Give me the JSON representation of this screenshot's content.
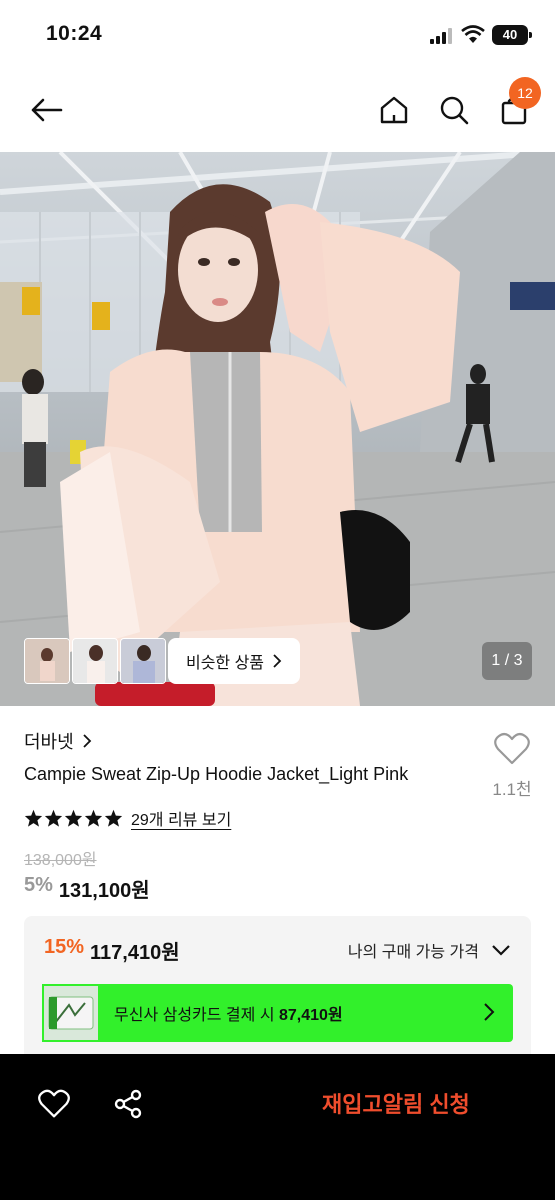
{
  "status_bar": {
    "time": "10:24",
    "battery": "40"
  },
  "nav": {
    "cart_count": "12"
  },
  "gallery": {
    "similar_label": "비슷한 상품",
    "page_indicator": "1 / 3"
  },
  "product": {
    "brand": "더바넷",
    "title": "Campie Sweat Zip-Up Hoodie Jacket_Light Pink",
    "wish_count": "1.1천",
    "review_link": "29개 리뷰 보기",
    "rating_stars": 5,
    "original_price": "138,000원",
    "discount_pct": "5%",
    "price": "131,100원"
  },
  "benefit": {
    "discount_pct": "15%",
    "price": "117,410원",
    "my_price_label": "나의 구매 가능 가격",
    "card_text": "무신사 삼성카드 결제 시",
    "card_price": "87,410원",
    "banner_color": "#32f02b"
  },
  "bottom_bar": {
    "restock_label": "재입고알림 신청"
  },
  "colors": {
    "accent": "#f26522",
    "restock": "#ef4d2d"
  }
}
